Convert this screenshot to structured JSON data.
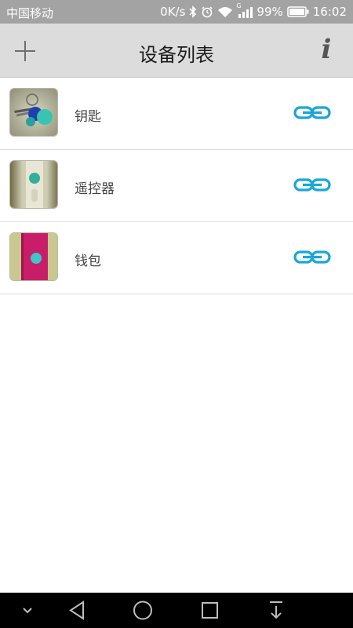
{
  "status_bar": {
    "carrier": "中国移动",
    "net_speed": "0K/s",
    "signal_type": "G",
    "battery": "99%",
    "time": "16:02"
  },
  "header": {
    "title": "设备列表",
    "info_label": "i",
    "add_icon": "plus-icon"
  },
  "devices": [
    {
      "label": "钥匙",
      "thumb": "keys-photo",
      "status_icon": "link-icon"
    },
    {
      "label": "遥控器",
      "thumb": "remote-photo",
      "status_icon": "link-icon"
    },
    {
      "label": "钱包",
      "thumb": "wallet-photo",
      "status_icon": "link-icon"
    }
  ],
  "colors": {
    "status_bar": "#a3a3a3",
    "header_bg": "#dcdcdc",
    "link_accent": "#1aa6d8",
    "nav_bar": "#000000"
  },
  "nav_bar": [
    "chevron-down-icon",
    "back-icon",
    "home-icon",
    "recents-icon",
    "notification-pull-icon"
  ]
}
